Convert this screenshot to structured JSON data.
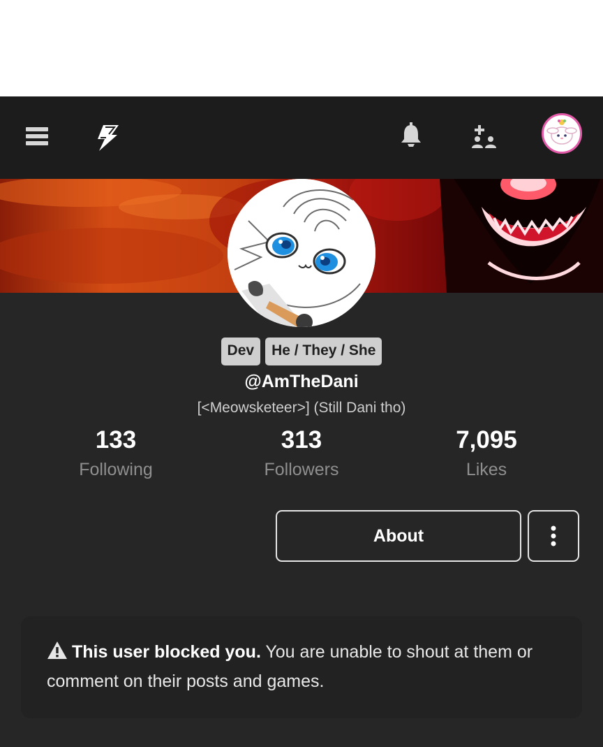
{
  "navbar": {
    "menu_icon": "hamburger-menu-icon",
    "logo_icon": "lightning-bolt-logo-icon",
    "notifications_icon": "bell-icon",
    "friends_icon": "add-friends-icon",
    "avatar_icon": "user-avatar-icon"
  },
  "profile": {
    "tags": [
      "Dev",
      "He / They / She"
    ],
    "username": "@AmTheDani",
    "display_name": "[<Meowsketeer>] (Still Dani tho)"
  },
  "stats": {
    "following": {
      "value": "133",
      "label": "Following"
    },
    "followers": {
      "value": "313",
      "label": "Followers"
    },
    "likes": {
      "value": "7,095",
      "label": "Likes"
    }
  },
  "actions": {
    "about_label": "About",
    "more_icon": "vertical-ellipsis-icon"
  },
  "notice": {
    "icon": "warning-triangle-icon",
    "bold_text": "This user blocked you.",
    "text": " You are unable to shout at them or comment on their posts and games."
  },
  "colors": {
    "navbar_bg": "#1c1c1c",
    "page_bg": "#262626",
    "tag_bg": "#cfcfcf",
    "muted_text": "#8f8f8f"
  }
}
